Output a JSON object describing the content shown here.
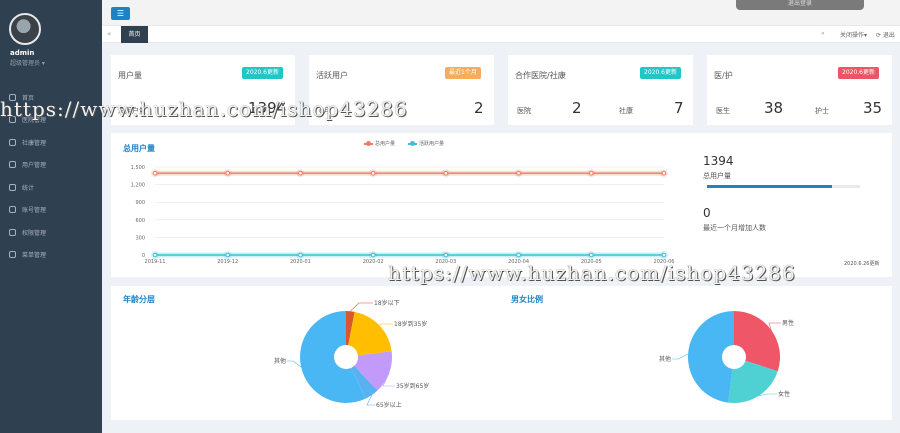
{
  "sidebar": {
    "user_name": "admin",
    "user_role": "超级管理员",
    "items": [
      {
        "label": "首页",
        "icon": "home-icon"
      },
      {
        "label": "医院管理",
        "icon": "hospital-icon"
      },
      {
        "label": "社康管理",
        "icon": "clinic-icon"
      },
      {
        "label": "用户管理",
        "icon": "user-icon"
      },
      {
        "label": "统计",
        "icon": "chart-icon"
      },
      {
        "label": "账号管理",
        "icon": "account-icon"
      },
      {
        "label": "权限管理",
        "icon": "lock-icon"
      },
      {
        "label": "菜单管理",
        "icon": "menu-icon"
      }
    ]
  },
  "topbar": {
    "menu_toggle": "☰",
    "top_button": "退出登录"
  },
  "tabs": {
    "left_arrow": "«",
    "active_tab": "首页",
    "right_arrow": "»",
    "close_ops": "关闭操作▾",
    "exit": "⟳ 退出"
  },
  "stats": [
    {
      "title": "用户量",
      "badge": "2020.6更新",
      "badge_color": "#23c6c8",
      "items": [
        {
          "label": "总用户量",
          "value": "1394"
        }
      ]
    },
    {
      "title": "活跃用户",
      "badge": "最近1个月",
      "badge_color": "#f8ac59",
      "items": [
        {
          "label": "6月",
          "value": "2"
        }
      ]
    },
    {
      "title": "合作医院/社康",
      "badge": "2020.6更新",
      "badge_color": "#23c6c8",
      "items": [
        {
          "label": "医院",
          "value": "2"
        },
        {
          "label": "社康",
          "value": "7"
        }
      ]
    },
    {
      "title": "医/护",
      "badge": "2020.6更新",
      "badge_color": "#ed5565",
      "items": [
        {
          "label": "医生",
          "value": "38"
        },
        {
          "label": "护士",
          "value": "35"
        }
      ]
    }
  ],
  "total_chart": {
    "title": "总用户量",
    "right_total": "1394",
    "right_total_label": "总用户量",
    "right_growth": "0",
    "right_growth_label": "最近一个月增加人数",
    "progress": 0.82,
    "update_note": "2020.6.26更新"
  },
  "chart_data": [
    {
      "type": "line",
      "title": "总用户量",
      "x": [
        "2019-11",
        "2019-12",
        "2020-01",
        "2020-02",
        "2020-03",
        "2020-04",
        "2020-05",
        "2020-06"
      ],
      "series": [
        {
          "name": "总用户量",
          "color": "#ed7d62",
          "values": [
            1394,
            1394,
            1394,
            1394,
            1394,
            1394,
            1394,
            1394
          ]
        },
        {
          "name": "活跃用户量",
          "color": "#3cc0d8",
          "values": [
            0,
            0,
            0,
            0,
            0,
            0,
            0,
            0
          ]
        }
      ],
      "yticks": [
        "0",
        "300",
        "600",
        "900",
        "1,200",
        "1,500"
      ],
      "ylim": [
        0,
        1500
      ],
      "grid": true,
      "legend": "top-center"
    },
    {
      "type": "pie",
      "title": "年龄分层",
      "categories": [
        "18岁以下",
        "18岁到35岁",
        "35岁到65岁",
        "65岁以上",
        "其他"
      ],
      "values": [
        3,
        20,
        15,
        5,
        57
      ],
      "colors": [
        "#d9572f",
        "#ffbf00",
        "#c29bfa",
        "#5ab1ef",
        "#4ab7f5"
      ]
    },
    {
      "type": "pie",
      "title": "男女比例",
      "categories": [
        "男性",
        "女性",
        "其他"
      ],
      "values": [
        30,
        22,
        48
      ],
      "colors": [
        "#ef5768",
        "#4fd1d4",
        "#4ab7f5"
      ]
    }
  ],
  "watermark": "https://www.huzhan.com/ishop43286"
}
